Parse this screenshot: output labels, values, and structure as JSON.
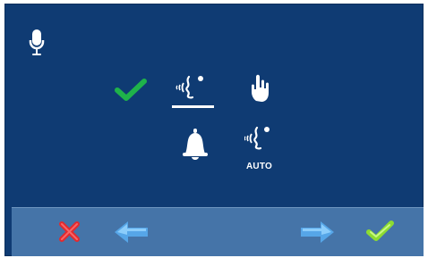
{
  "screen": {
    "background_color": "#0f3b73",
    "toolbar_color": "#4574a8",
    "top_left_icon": "microphone-icon",
    "modes": [
      {
        "icon": "check-icon",
        "color": "#1fb24a"
      },
      {
        "icon": "talk-icon",
        "selected": true
      },
      {
        "icon": "hand-icon"
      },
      {
        "icon": "bell-icon"
      },
      {
        "icon": "auto-talk-icon",
        "label": "AUTO"
      }
    ]
  },
  "toolbar": {
    "buttons": [
      {
        "icon": "close-icon",
        "color": "#e22a2f"
      },
      {
        "icon": "arrow-left-icon",
        "color": "#56a6e8"
      },
      {
        "icon": "arrow-right-icon",
        "color": "#56a6e8"
      },
      {
        "icon": "confirm-check-icon",
        "color": "#8ddc31"
      }
    ]
  }
}
